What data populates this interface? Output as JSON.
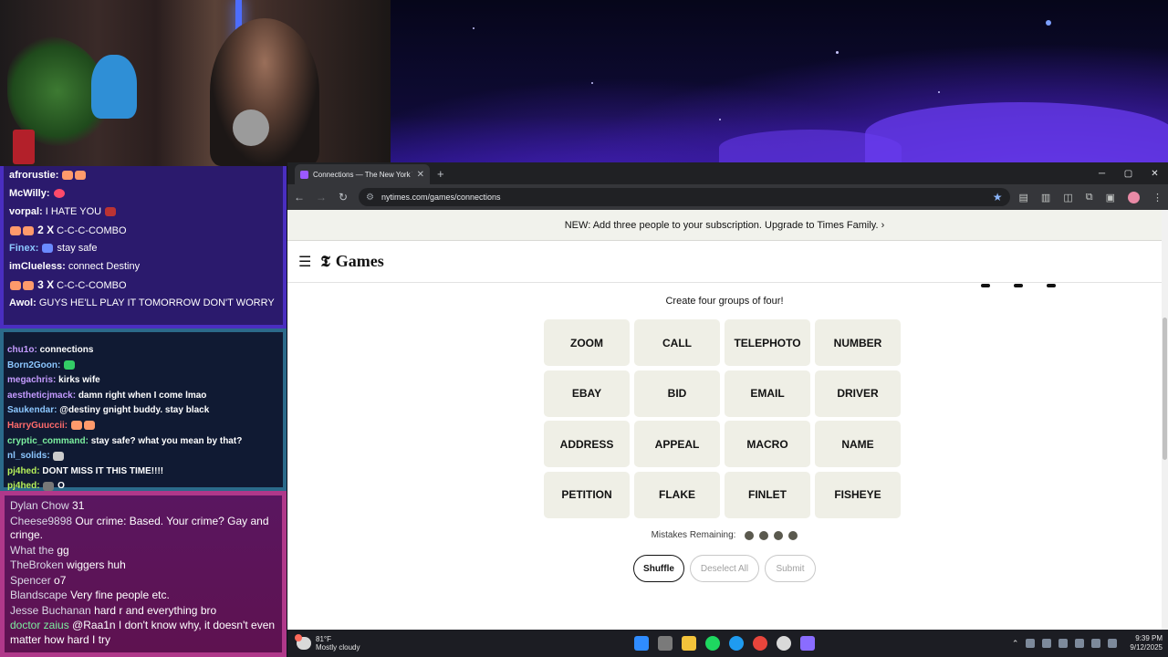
{
  "stream": {
    "chat_top": [
      {
        "user": "afrorustie:",
        "msg": "",
        "color": "#ffffff"
      },
      {
        "user": "McWilly:",
        "msg": "",
        "color": "#ffffff"
      },
      {
        "user": "vorpal:",
        "msg": "I HATE YOU",
        "color": "#ffffff"
      },
      {
        "user": "2 X",
        "msg": "C-C-C-COMBO",
        "color": "#ffffff"
      },
      {
        "user": "Finex:",
        "msg": "stay safe",
        "color": "#8cc7ff"
      },
      {
        "user": "imClueless:",
        "msg": "connect Destiny",
        "color": "#ffffff"
      },
      {
        "user": "3 X",
        "msg": "C-C-C-COMBO",
        "color": "#ffffff"
      },
      {
        "user": "Awol:",
        "msg": "GUYS HE'LL PLAY IT TOMORROW DON'T WORRY",
        "color": "#ffffff"
      }
    ],
    "chat_mid": [
      {
        "user": "chu1o:",
        "msg": "connections",
        "color": "#c49bff"
      },
      {
        "user": "Born2Goon:",
        "msg": "",
        "color": "#8cc7ff"
      },
      {
        "user": "megachris:",
        "msg": "kirks wife",
        "color": "#c49bff"
      },
      {
        "user": "aestheticjmack:",
        "msg": "damn right when I come lmao",
        "color": "#c49bff"
      },
      {
        "user": "Saukendar:",
        "msg": "@destiny gnight buddy. stay black",
        "color": "#8cc7ff"
      },
      {
        "user": "HarryGuuccii:",
        "msg": "",
        "color": "#ff6b6b"
      },
      {
        "user": "cryptic_command:",
        "msg": "stay safe? what you mean by that?",
        "color": "#7cf0a0"
      },
      {
        "user": "nl_solids:",
        "msg": "",
        "color": "#8cc7ff"
      },
      {
        "user": "pj4hed:",
        "msg": "DONT MISS IT THIS TIME!!!!",
        "color": "#b6f05a"
      },
      {
        "user": "pj4hed:",
        "msg": "O",
        "color": "#b6f05a"
      }
    ],
    "chat_bottom": [
      {
        "user": "Dylan Chow",
        "msg": "31",
        "color": "#d9d9e6"
      },
      {
        "user": "Cheese9898",
        "msg": "Our crime: Based. Your crime? Gay and cringe.",
        "color": "#d9d9e6"
      },
      {
        "user": "What the",
        "msg": "gg",
        "color": "#d9d9e6"
      },
      {
        "user": "TheBroken",
        "msg": "wiggers huh",
        "color": "#d9d9e6"
      },
      {
        "user": "Spencer",
        "msg": "o7",
        "color": "#d9d9e6"
      },
      {
        "user": "Blandscape",
        "msg": "Very fine people etc.",
        "color": "#d9d9e6"
      },
      {
        "user": "Jesse Buchanan",
        "msg": "hard r and everything bro",
        "color": "#d9d9e6"
      },
      {
        "user": "doctor zaius",
        "msg": "@Raa1n I don't know why, it doesn't even matter how hard I try",
        "color": "#7cf0a0"
      }
    ]
  },
  "browser": {
    "tab_title": "Connections — The New York T",
    "url": "nytimes.com/games/connections",
    "new_tab": "+",
    "win_min": "─",
    "win_max": "▢",
    "win_close": "✕",
    "back": "←",
    "forward": "→",
    "reload": "↻",
    "tune": "⚙",
    "star": "★",
    "ext_icons": [
      "▤",
      "▥",
      "◫",
      "⧉",
      "▣"
    ],
    "menu": "⋮"
  },
  "page": {
    "banner": "NEW: Add three people to your subscription. Upgrade to Times Family. ›",
    "logo_mark": "𝕿",
    "logo_text": "Games",
    "hamburger": "☰",
    "subtitle": "Create four groups of four!",
    "tiles": [
      "ZOOM",
      "CALL",
      "TELEPHOTO",
      "NUMBER",
      "EBAY",
      "BID",
      "EMAIL",
      "DRIVER",
      "ADDRESS",
      "APPEAL",
      "MACRO",
      "NAME",
      "PETITION",
      "FLAKE",
      "FINLET",
      "FISHEYE"
    ],
    "mistakes_label": "Mistakes Remaining:",
    "mistakes_remaining": 4,
    "buttons": {
      "shuffle": "Shuffle",
      "deselect": "Deselect All",
      "submit": "Submit"
    }
  },
  "taskbar": {
    "temp": "81°F",
    "condition": "Mostly cloudy",
    "time": "9:39 PM",
    "date": "9/12/2025",
    "app_colors": [
      "#2f8cff",
      "#7a7a7a",
      "#f3c33b",
      "#1ed760",
      "#1f9bf0",
      "#e8453c",
      "#d9d9d9",
      "#8a6cff"
    ]
  }
}
